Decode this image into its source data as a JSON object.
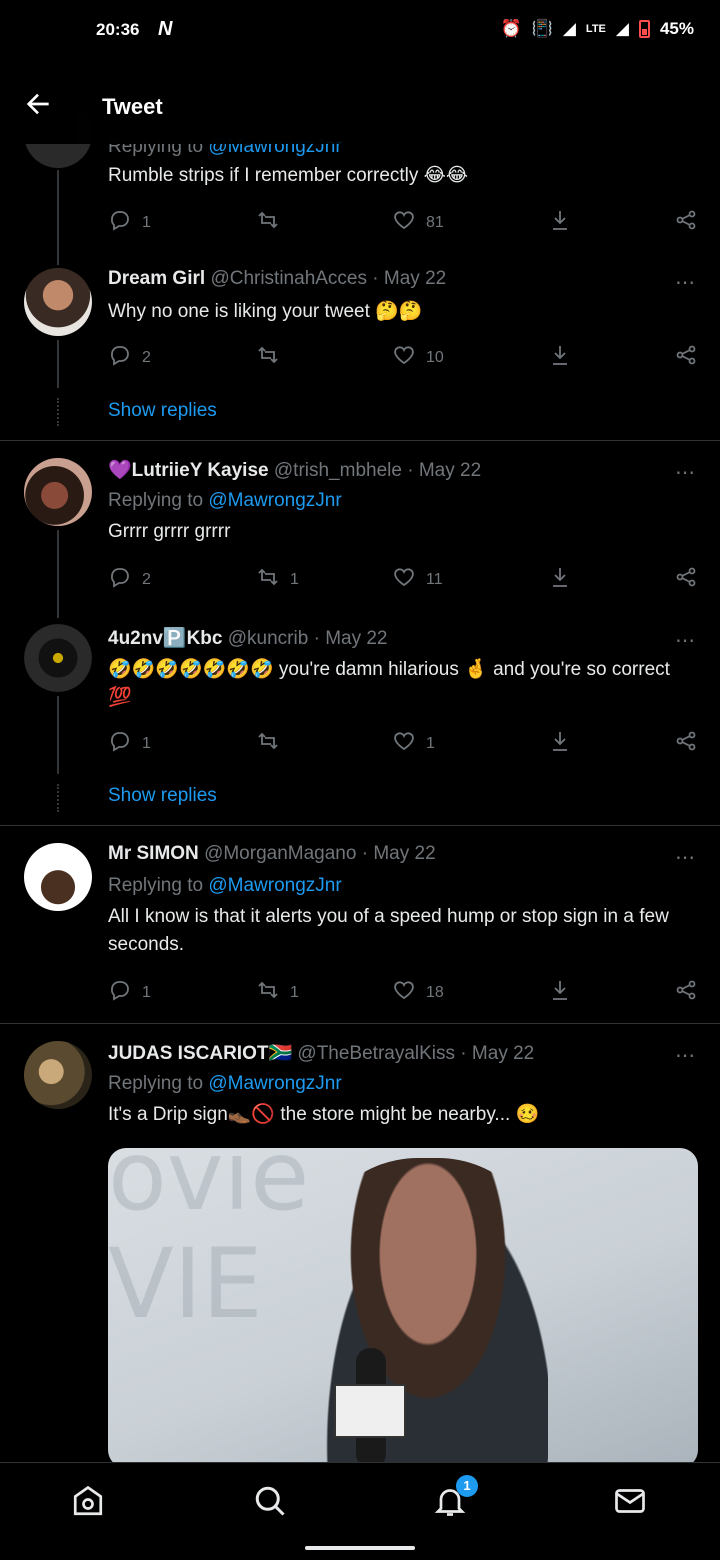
{
  "status_bar": {
    "time": "20:36",
    "battery": "45%",
    "network": "LTE"
  },
  "header": {
    "title": "Tweet"
  },
  "tweets": [
    {
      "reply_to_prefix": "Replying to ",
      "reply_to_handle": "@MawrongzJnr",
      "text": "Rumble strips if I remember correctly 😂😂",
      "replies": "1",
      "retweets": "",
      "likes": "81"
    },
    {
      "name": "Dream Girl",
      "handle": "@ChristinahAcces",
      "date": "May 22",
      "text": "Why no one is liking your tweet 🤔🤔",
      "replies": "2",
      "retweets": "",
      "likes": "10",
      "show_replies": "Show replies"
    },
    {
      "name": "💜LutriieY Kayise",
      "handle": "@trish_mbhele",
      "date": "May 22",
      "reply_to_prefix": "Replying to ",
      "reply_to_handle": "@MawrongzJnr",
      "text": "Grrrr grrrr grrrr",
      "replies": "2",
      "retweets": "1",
      "likes": "11"
    },
    {
      "name": "4u2nv🅿️Kbc",
      "handle": "@kuncrib",
      "date": "May 22",
      "text": "🤣🤣🤣🤣🤣🤣🤣 you're damn hilarious 🤞 and you're so correct 💯",
      "replies": "1",
      "retweets": "",
      "likes": "1",
      "show_replies": "Show replies"
    },
    {
      "name": "Mr SIMON",
      "handle": "@MorganMagano",
      "date": "May 22",
      "reply_to_prefix": "Replying to ",
      "reply_to_handle": "@MawrongzJnr",
      "text": "All I know is that it alerts you of a speed hump or stop sign in a few seconds.",
      "replies": "1",
      "retweets": "1",
      "likes": "18"
    },
    {
      "name": "JUDAS ISCARIOT🇿🇦",
      "handle": "@TheBetrayalKiss",
      "date": "May 22",
      "reply_to_prefix": "Replying to ",
      "reply_to_handle": "@MawrongzJnr",
      "text": "It's a Drip sign👞🚫 the store might be nearby... 🥴",
      "media_text_1": "ovie",
      "media_text_2": "VIE"
    }
  ],
  "more_icon": "⋯",
  "separator": " · ",
  "notifications_badge": "1",
  "icons": [
    "back-arrow-icon",
    "reply-icon",
    "retweet-icon",
    "like-icon",
    "share-icon",
    "more-icon",
    "home-icon",
    "search-icon",
    "bell-icon",
    "mail-icon"
  ]
}
